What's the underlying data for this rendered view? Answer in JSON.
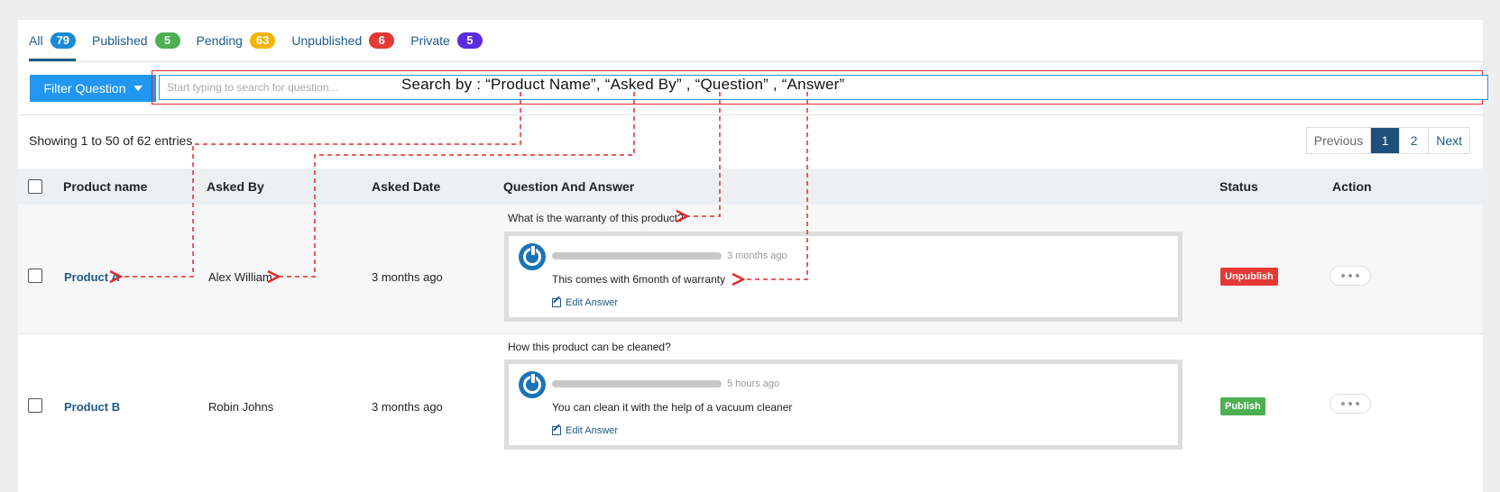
{
  "tabs": [
    {
      "label": "All",
      "count": "79",
      "color": "#1a8ad8"
    },
    {
      "label": "Published",
      "count": "5",
      "color": "#4caf50"
    },
    {
      "label": "Pending",
      "count": "63",
      "color": "#f5b400"
    },
    {
      "label": "Unpublished",
      "count": "6",
      "color": "#e53935"
    },
    {
      "label": "Private",
      "count": "5",
      "color": "#5b2be0"
    }
  ],
  "filter": {
    "button_label": "Filter Question",
    "search_placeholder": "Start typing to search for question...",
    "search_annotation": "Search by :  “Product Name”, “Asked By” , “Question” , “Answer”"
  },
  "info": {
    "showing": "Showing 1 to 50 of 62 entries"
  },
  "pagination": {
    "previous": "Previous",
    "pages": [
      "1",
      "2"
    ],
    "next": "Next",
    "active_page": "1"
  },
  "table": {
    "headers": {
      "product": "Product name",
      "asked_by": "Asked By",
      "asked_date": "Asked Date",
      "qa": "Question And Answer",
      "status": "Status",
      "action": "Action"
    },
    "rows": [
      {
        "product": "Product A",
        "asked_by": "Alex William",
        "asked_date": "3 months ago",
        "question": "What is the warranty of this product?",
        "answer_time": "3 months ago",
        "answer": "This comes with 6month of warranty",
        "edit_label": "Edit Answer",
        "status": "Unpublish",
        "status_color": "#e53935"
      },
      {
        "product": "Product B",
        "asked_by": "Robin Johns",
        "asked_date": "3 months ago",
        "question": "How this product can be cleaned?",
        "answer_time": "5 hours ago",
        "answer": "You can clean it with the help of a vacuum cleaner",
        "edit_label": "Edit Answer",
        "status": "Publish",
        "status_color": "#4caf50"
      }
    ]
  },
  "colors": {
    "primary": "#2196f3",
    "link": "#1d5a8a",
    "annotation_red": "#e62828"
  }
}
